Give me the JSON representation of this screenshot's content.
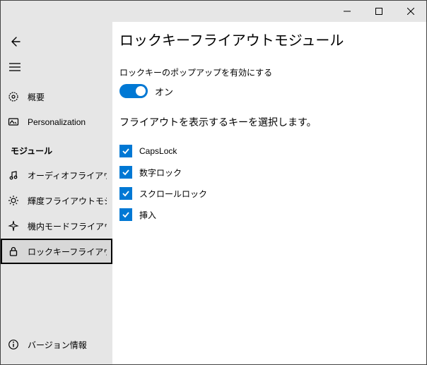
{
  "titlebar": {
    "min_label": "",
    "max_label": "",
    "close_label": ""
  },
  "sidebar": {
    "top": {
      "overview": "概要",
      "personalization": "Personalization"
    },
    "modules_header": "モジュール",
    "modules": [
      {
        "label": "オーディオフライアウトモジュール"
      },
      {
        "label": "輝度フライアウトモジュール"
      },
      {
        "label": "機内モードフライアウトモジュール"
      },
      {
        "label": "ロックキーフライアウトモジュール"
      }
    ],
    "footer": {
      "about": "バージョン情報"
    }
  },
  "content": {
    "title": "ロックキーフライアウトモジュール",
    "enable_label": "ロックキーのポップアップを有効にする",
    "toggle_text": "オン",
    "select_keys_label": "フライアウトを表示するキーを選択します。",
    "keys": [
      {
        "label": "CapsLock"
      },
      {
        "label": "数字ロック"
      },
      {
        "label": "スクロールロック"
      },
      {
        "label": "挿入"
      }
    ]
  }
}
